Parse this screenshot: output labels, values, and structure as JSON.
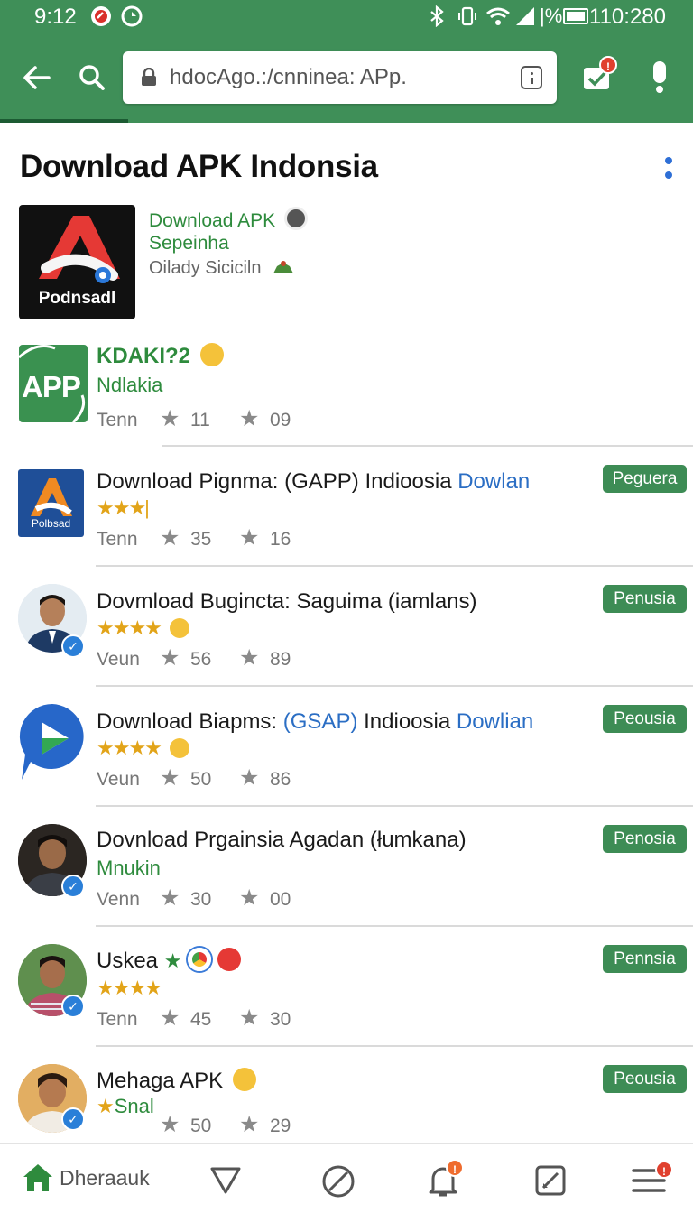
{
  "status_bar": {
    "time": "9:12",
    "right_text": "110:280",
    "battery_text": "|%"
  },
  "toolbar": {
    "back_icon": "back-arrow-icon",
    "search_icon": "search-icon",
    "url": "hdocAgo.:/cnninea: APp.",
    "checklist_badge": "!",
    "colors": {
      "toolbar": "#3f8f58",
      "accent": "#2e8b3d",
      "link": "#2b6ec4",
      "stars": "#e2a419"
    }
  },
  "page": {
    "title": "Download APK Indonsia"
  },
  "featured": {
    "icon_caption": "Podnsadl",
    "title": "Download APK",
    "subtitle": "Sepeinha",
    "meta": "Oilady Siciciln"
  },
  "app2": {
    "icon_text": "APP",
    "title": "KDAKI?2",
    "subtitle": "Ndlakia",
    "label": "Tenn",
    "rating_a": "11",
    "rating_b": "09"
  },
  "rows": [
    {
      "title": "Download Pignma: ",
      "pill": "(GAPP)",
      "mid": " Indioosia ",
      "link": "Dowlan",
      "stars": "★★★|",
      "label": "Tenn",
      "a": "35",
      "b": "16",
      "tag": "Peguera",
      "icon_caption": "Polbsad"
    },
    {
      "title": "Dovmload Bugincta: Saguima (iamlans)",
      "stars": "★★★★",
      "label": "Veun",
      "a": "56",
      "b": "89",
      "tag": "Penusia"
    },
    {
      "title": "Download Biapms: ",
      "pill": "(GSAP)",
      "mid": " Indioosia ",
      "link": "Dowlian",
      "stars": "★★★★",
      "label": "Veun",
      "a": "50",
      "b": "86",
      "tag": "Peousia"
    },
    {
      "title": "Dovnload Prgainsia Agadan (łumkana)",
      "sub": "Mnukin",
      "label": "Venn",
      "a": "30",
      "b": "00",
      "tag": "Penosia"
    },
    {
      "title": "Uskea",
      "stars": "★★★★",
      "label": "Tenn",
      "a": "45",
      "b": "30",
      "tag": "Pennsia"
    },
    {
      "title": "Mehaga  APK",
      "sub": "Snal",
      "a": "50",
      "b": "29",
      "tag": "Peousia"
    }
  ],
  "bottom_nav": {
    "home_label": "Dheraauk",
    "bell_badge": "!",
    "menu_badge": "!"
  }
}
